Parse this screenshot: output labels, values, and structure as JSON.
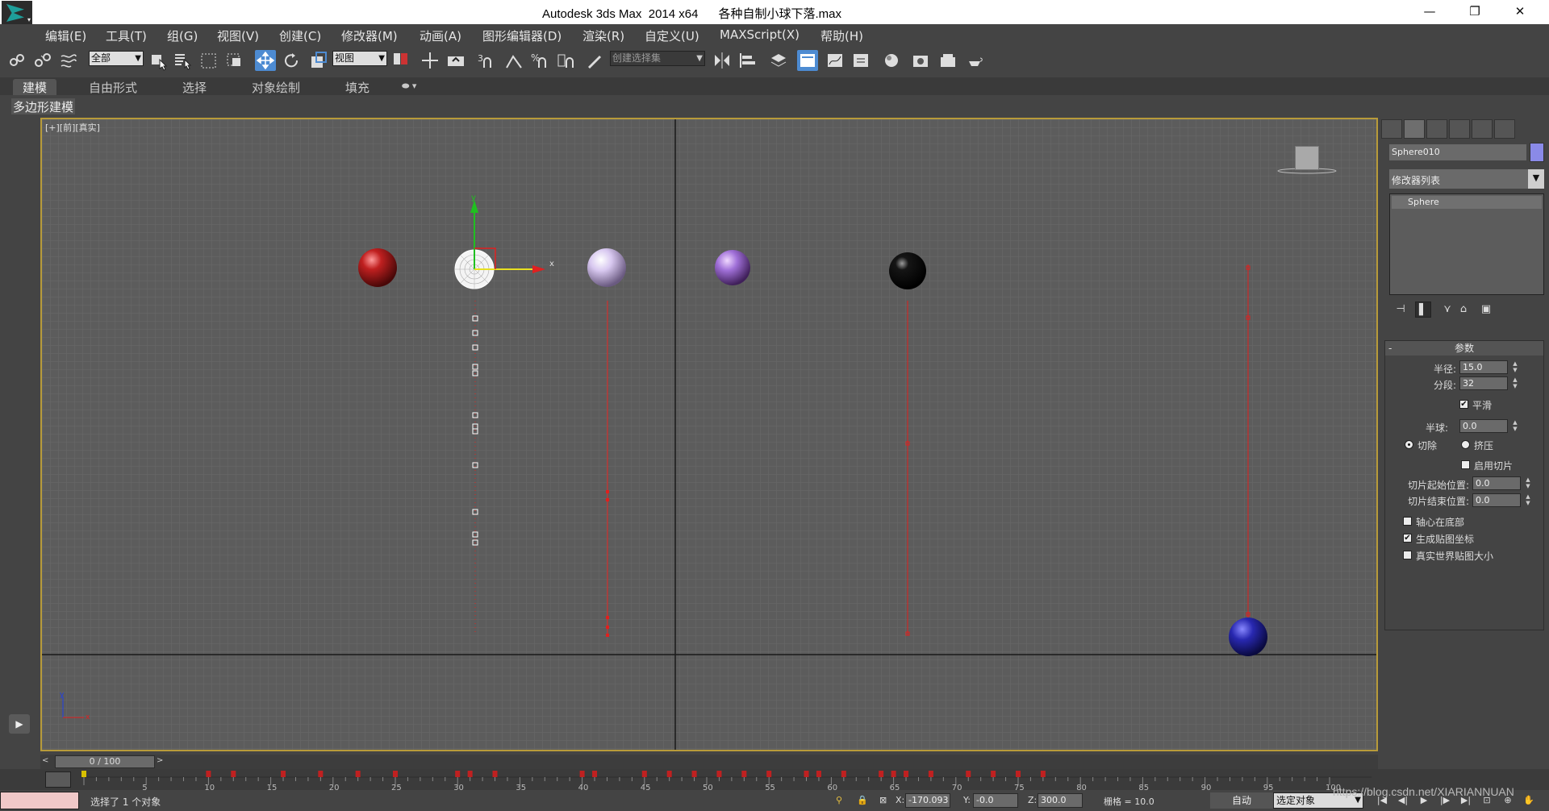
{
  "title": {
    "text": "Autodesk 3ds Max  2014 x64      各种自制小球下落.max",
    "min": "—",
    "restore": "❐",
    "close": "✕"
  },
  "menu": [
    "编辑(E)",
    "工具(T)",
    "组(G)",
    "视图(V)",
    "创建(C)",
    "修改器(M)",
    "动画(A)",
    "图形编辑器(D)",
    "渲染(R)",
    "自定义(U)",
    "MAXScript(X)",
    "帮助(H)"
  ],
  "toolbar": {
    "filter_dropdown": "全部",
    "coord_dropdown": "视图",
    "selection_set_dropdown": "创建选择集"
  },
  "ribbon": {
    "tabs": [
      "建模",
      "自由形式",
      "选择",
      "对象绘制",
      "填充"
    ],
    "active_tab": "建模",
    "sub_label": "多边形建模"
  },
  "viewport": {
    "label": "[+][前][真实]",
    "axis_x": "x",
    "axis_y": "y",
    "gizmo_x": "x",
    "gizmo_y": "y"
  },
  "command_panel": {
    "object_name": "Sphere010",
    "object_color": "#8a8ae8",
    "modifier_list": "修改器列表",
    "stack_item": "Sphere",
    "params": {
      "rollout_title": "参数",
      "radius_label": "半径:",
      "radius": "15.0",
      "segments_label": "分段:",
      "segments": "32",
      "smooth_label": "平滑",
      "smooth": true,
      "hemisphere_label": "半球:",
      "hemisphere": "0.0",
      "chop_label": "切除",
      "squash_label": "挤压",
      "enable_slice_label": "启用切片",
      "slice_from_label": "切片起始位置:",
      "slice_from": "0.0",
      "slice_to_label": "切片结束位置:",
      "slice_to": "0.0",
      "base_to_pivot_label": "轴心在底部",
      "gen_mapping_label": "生成贴图坐标",
      "real_world_label": "真实世界贴图大小"
    }
  },
  "timeline": {
    "frame": "0 / 100",
    "prev": "<",
    "next": ">",
    "ticks": [
      "5",
      "10",
      "15",
      "20",
      "25",
      "30",
      "35",
      "40",
      "45",
      "50",
      "55",
      "60",
      "65",
      "70",
      "75",
      "80",
      "85",
      "90",
      "95",
      "100"
    ]
  },
  "status": {
    "message": "选择了 1 个对象",
    "x_label": "X:",
    "x": "-170.093",
    "y_label": "Y:",
    "y": "-0.0",
    "z_label": "Z:",
    "z": "300.0",
    "grid": "栅格 = 10.0",
    "auto_key": "自动",
    "selected_dropdown": "选定对象",
    "watermark": "https://blog.csdn.net/XIARIANNUAN"
  },
  "colors": {
    "viewport_bg": "#5c5c5c",
    "grid": "#6e6e6e",
    "viewport_border": "#b89b3a",
    "active_blue": "#4d8bd2",
    "trajectory": "#e0201e"
  },
  "balls": [
    {
      "name": "red-ball",
      "color": "#c02020"
    },
    {
      "name": "selected-white-ball",
      "color": "#ffffff"
    },
    {
      "name": "lavender-ball",
      "color": "#d8c8f0"
    },
    {
      "name": "purple-ball",
      "color": "#a070d8"
    },
    {
      "name": "black-ball",
      "color": "#050505"
    },
    {
      "name": "blue-ball",
      "color": "#2828b0"
    }
  ]
}
